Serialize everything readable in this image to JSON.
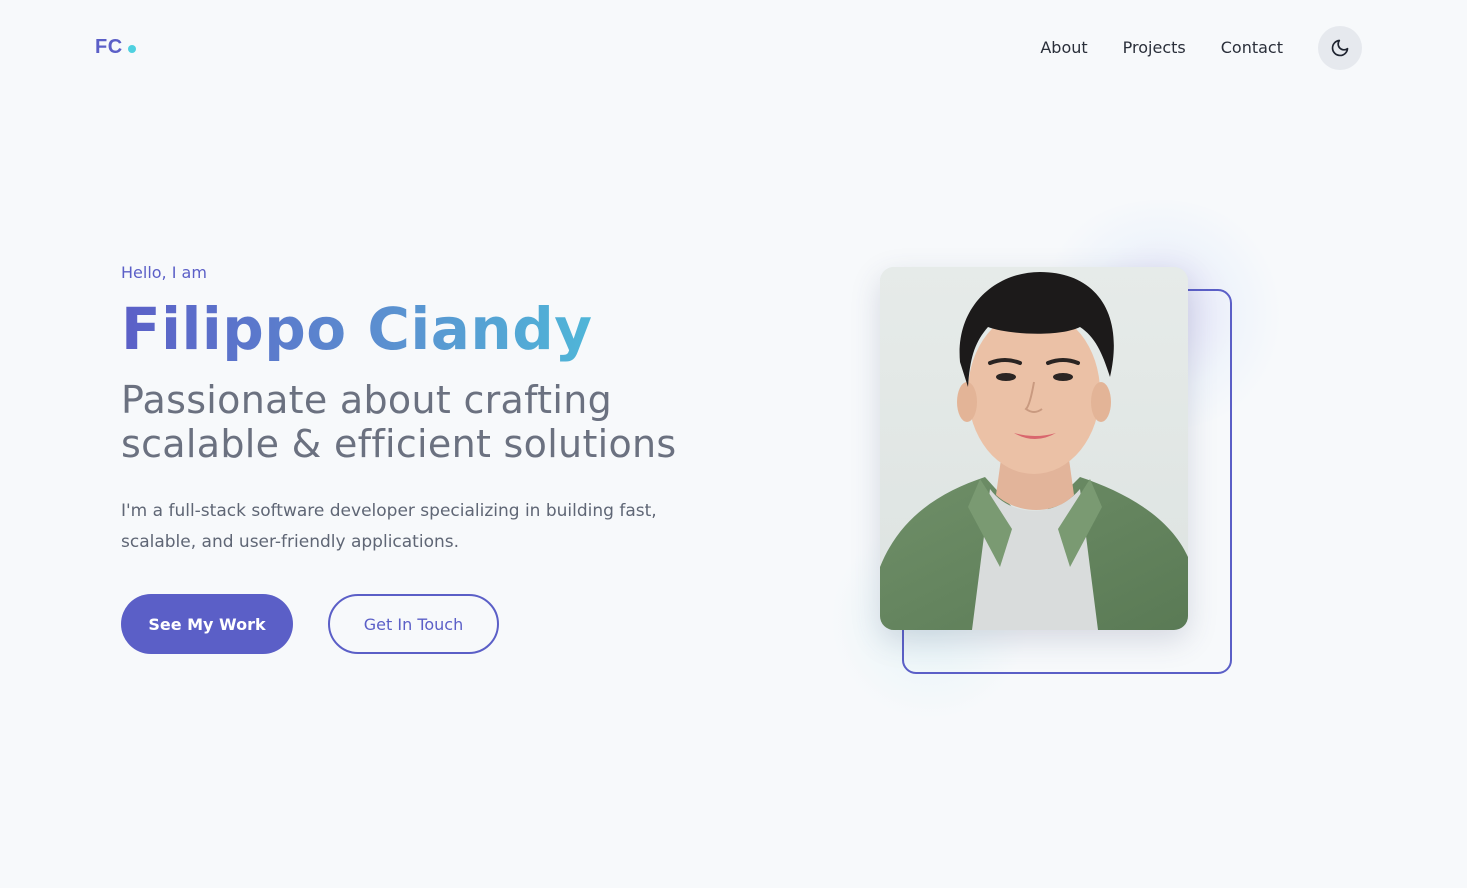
{
  "header": {
    "logo_text": "FC",
    "nav": [
      {
        "label": "About"
      },
      {
        "label": "Projects"
      },
      {
        "label": "Contact"
      }
    ],
    "theme_toggle_icon": "moon-icon"
  },
  "hero": {
    "greeting": "Hello, I am",
    "name": "Filippo Ciandy",
    "tagline_line1": "Passionate about crafting",
    "tagline_line2": "scalable & efficient solutions",
    "description": "I'm a full-stack software developer specializing in building fast, scalable, and user-friendly applications.",
    "primary_button": "See My Work",
    "secondary_button": "Get In Touch"
  },
  "portrait": {
    "image": "profile-photo"
  },
  "colors": {
    "accent": "#5b5fc7",
    "accent_cyan": "#4fd1e0",
    "background": "#f7f9fb",
    "text_muted": "#6b7180"
  }
}
